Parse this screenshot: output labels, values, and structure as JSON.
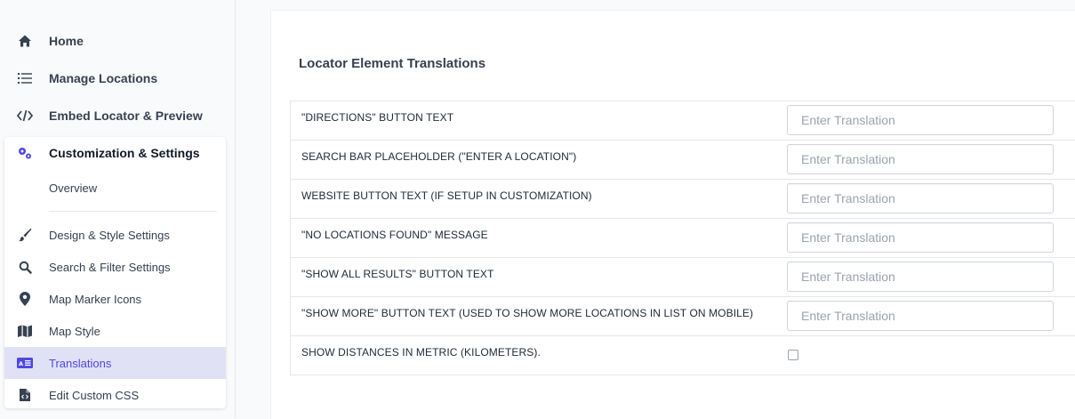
{
  "sidebar": {
    "items": [
      {
        "label": "Home",
        "icon": "home-icon"
      },
      {
        "label": "Manage Locations",
        "icon": "list-icon"
      },
      {
        "label": "Embed Locator & Preview",
        "icon": "code-icon"
      },
      {
        "label": "Customization & Settings",
        "icon": "gears-icon"
      }
    ],
    "overview_label": "Overview",
    "sub_items": [
      {
        "label": "Design & Style Settings",
        "icon": "paintbrush-icon"
      },
      {
        "label": "Search & Filter Settings",
        "icon": "search-icon"
      },
      {
        "label": "Map Marker Icons",
        "icon": "map-marker-icon"
      },
      {
        "label": "Map Style",
        "icon": "map-icon"
      },
      {
        "label": "Translations",
        "icon": "translate-icon"
      },
      {
        "label": "Edit Custom CSS",
        "icon": "file-code-icon"
      }
    ],
    "active_color": "#4f46e5",
    "active_background": "#e0e1f5"
  },
  "main": {
    "title": "Locator Element Translations",
    "input_placeholder": "Enter Translation",
    "rows": [
      {
        "label": "\"DIRECTIONS\" BUTTON TEXT",
        "value": ""
      },
      {
        "label": "SEARCH BAR PLACEHOLDER (\"ENTER A LOCATION\")",
        "value": ""
      },
      {
        "label": "WEBSITE BUTTON TEXT (IF SETUP IN CUSTOMIZATION)",
        "value": ""
      },
      {
        "label": "\"NO LOCATIONS FOUND\" MESSAGE",
        "value": ""
      },
      {
        "label": "\"SHOW ALL RESULTS\" BUTTON TEXT",
        "value": ""
      },
      {
        "label": "\"SHOW MORE\" BUTTON TEXT (USED TO SHOW MORE LOCATIONS IN LIST ON MOBILE)",
        "value": ""
      }
    ],
    "checkbox_row": {
      "label": "SHOW DISTANCES IN METRIC (KILOMETERS).",
      "checked": false
    }
  }
}
